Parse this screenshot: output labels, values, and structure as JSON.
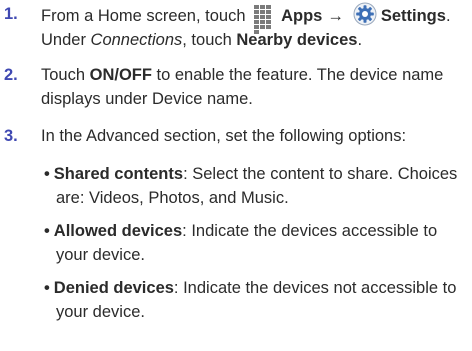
{
  "steps": [
    {
      "number": "1.",
      "line1": {
        "t1": "From a Home screen, touch",
        "apps": "Apps",
        "arrow": "→",
        "settings": "Settings",
        "tail": "."
      },
      "line2": {
        "t1": "Under ",
        "connections": "Connections",
        "t2": ", touch ",
        "nearby": "Nearby devices",
        "tail": "."
      }
    },
    {
      "number": "2.",
      "t1": "Touch ",
      "onoff": "ON/OFF",
      "t2": " to enable the feature. The device name",
      "t3": "displays under Device name."
    },
    {
      "number": "3.",
      "text": "In the Advanced section, set the following options:"
    }
  ],
  "bullets": [
    {
      "label": "Shared contents",
      "line1": ": Select the content to share. Choices",
      "line2": "are: Videos, Photos, and Music."
    },
    {
      "label": "Allowed devices",
      "line1": ": Indicate the devices accessible to",
      "line2": "your device."
    },
    {
      "label": "Denied devices",
      "line1": ": Indicate the devices not accessible to",
      "line2": "your device."
    }
  ],
  "bullet_glyph": "•",
  "icons": [
    "apps-grid-icon",
    "settings-gear-icon"
  ],
  "colors": {
    "step_number": "#3f48b2",
    "text": "#2b2b2b",
    "icon_gray": "#7b7b7b",
    "gear_blue": "#3d6fb6"
  }
}
